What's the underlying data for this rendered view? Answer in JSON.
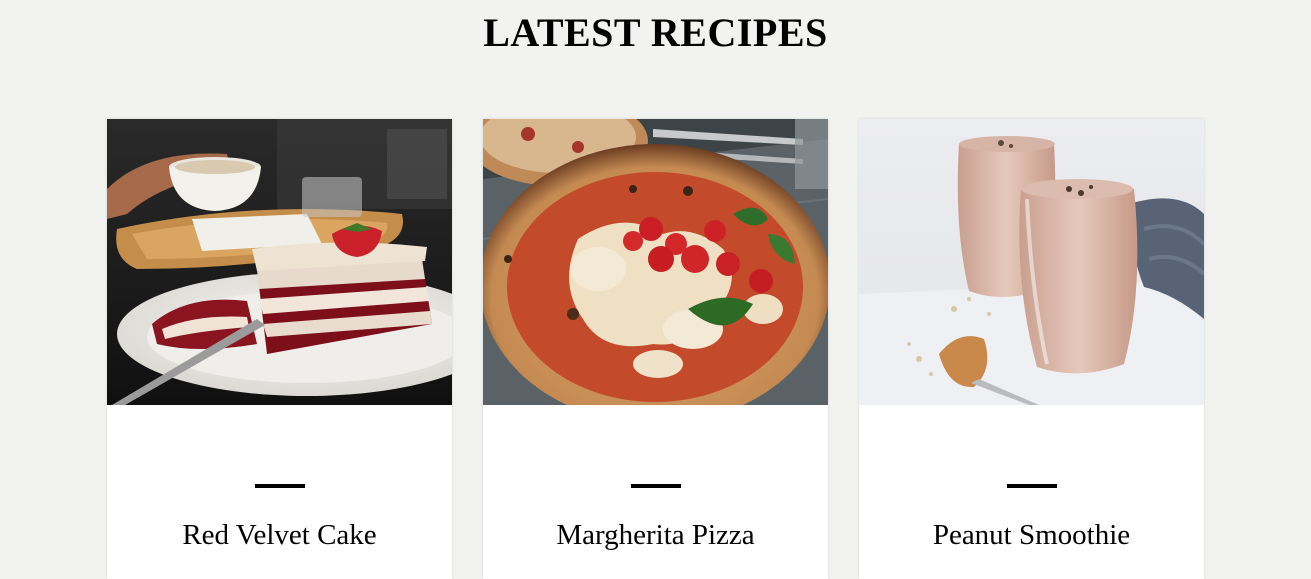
{
  "section": {
    "title": "LATEST RECIPES"
  },
  "recipes": [
    {
      "name": "Red Velvet Cake",
      "image": "red-velvet-cake-photo"
    },
    {
      "name": "Margherita Pizza",
      "image": "margherita-pizza-photo"
    },
    {
      "name": "Peanut Smoothie",
      "image": "peanut-smoothie-photo"
    }
  ]
}
